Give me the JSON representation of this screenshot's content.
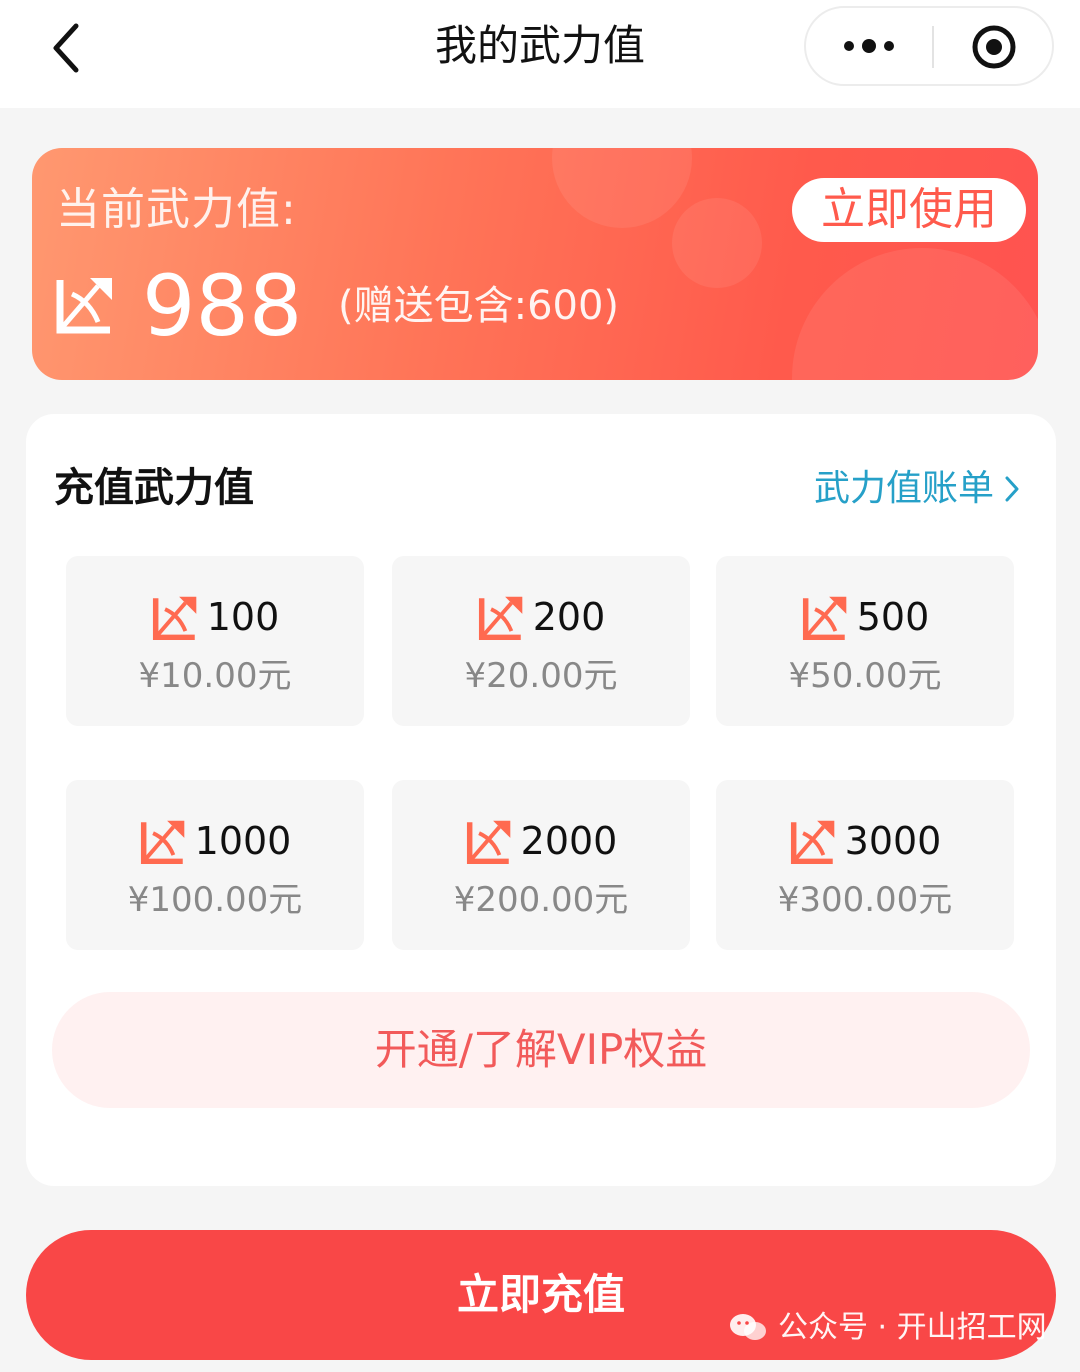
{
  "nav": {
    "title": "我的武力值",
    "back_icon": "chevron-left-icon",
    "more_icon": "more-dots-icon",
    "close_icon": "target-circle-icon"
  },
  "balance": {
    "label": "当前武力值:",
    "value": "988",
    "gift_note": "(赠送包含:600)",
    "use_button": "立即使用",
    "icon": "bow-arrow-icon"
  },
  "recharge": {
    "title": "充值武力值",
    "bill_link": "武力值账单",
    "options": [
      {
        "amount": "100",
        "price": "¥10.00元"
      },
      {
        "amount": "200",
        "price": "¥20.00元"
      },
      {
        "amount": "500",
        "price": "¥50.00元"
      },
      {
        "amount": "1000",
        "price": "¥100.00元"
      },
      {
        "amount": "2000",
        "price": "¥200.00元"
      },
      {
        "amount": "3000",
        "price": "¥300.00元"
      }
    ],
    "vip_button": "开通/了解VIP权益"
  },
  "footer": {
    "charge_button": "立即充值",
    "watermark": "公众号 · 开山招工网"
  },
  "colors": {
    "accent_red": "#f94747",
    "banner_start": "#ff9870",
    "banner_end": "#ff5350",
    "link_blue": "#26a0c8",
    "vip_text": "#f25a5a",
    "vip_bg": "#fff1f1"
  }
}
